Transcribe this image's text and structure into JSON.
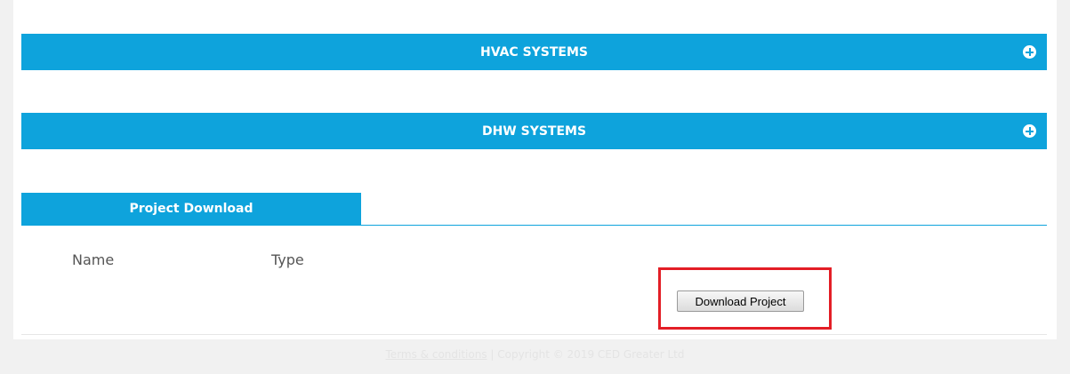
{
  "sections": [
    {
      "title": "HVAC SYSTEMS",
      "icon": "plus-circle-icon"
    },
    {
      "title": "DHW SYSTEMS",
      "icon": "plus-circle-icon"
    }
  ],
  "project_download": {
    "tab_label": "Project Download",
    "columns": [
      "Name",
      "Type"
    ],
    "button_label": "Download Project"
  },
  "footer": {
    "link_label": "Terms & conditions",
    "separator": "|",
    "copyright": "Copyright © 2019 CED Greater Ltd"
  },
  "colors": {
    "accent": "#0ea3dc",
    "highlight": "#e31e26"
  }
}
